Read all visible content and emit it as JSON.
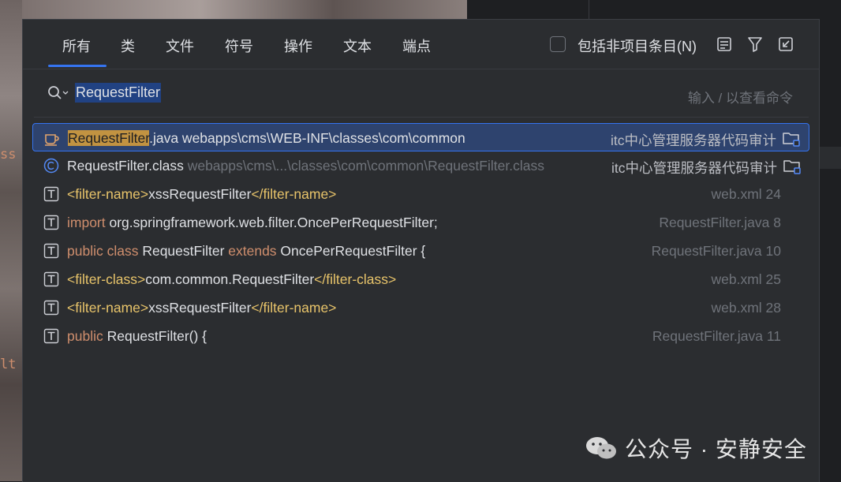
{
  "background": {
    "code_fragments": [
      "ss",
      "lt"
    ]
  },
  "tabs": [
    {
      "label": "所有",
      "active": true
    },
    {
      "label": "类"
    },
    {
      "label": "文件"
    },
    {
      "label": "符号"
    },
    {
      "label": "操作"
    },
    {
      "label": "文本"
    },
    {
      "label": "端点"
    }
  ],
  "include_non_project": {
    "label": "包括非项目条目(N)",
    "checked": false
  },
  "toolbar_icons": [
    "preview-icon",
    "filter-icon",
    "collapse-icon"
  ],
  "search": {
    "value": "RequestFilter",
    "hint": "输入 / 以查看命令"
  },
  "results": [
    {
      "icon": "java-file-icon",
      "selected": true,
      "name_highlight": "RequestFilter",
      "name_rest": ".java webapps\\cms\\WEB-INF\\classes\\com\\common",
      "project": "itc中心管理服务器代码审计"
    },
    {
      "icon": "class-icon",
      "name": "RequestFilter.class",
      "path": " webapps\\cms\\...\\classes\\com\\common\\RequestFilter.class",
      "project": "itc中心管理服务器代码审计"
    },
    {
      "icon": "text-icon",
      "parts": [
        [
          "tag",
          "<filter-name>"
        ],
        [
          "plain",
          "xssRequestFilter"
        ],
        [
          "tag",
          "</filter-name>"
        ]
      ],
      "location": "web.xml 24"
    },
    {
      "icon": "text-icon",
      "parts": [
        [
          "kw",
          "import"
        ],
        [
          "plain",
          " org.springframework.web.filter.OncePerRequestFilter;"
        ]
      ],
      "location": "RequestFilter.java 8"
    },
    {
      "icon": "text-icon",
      "parts": [
        [
          "kw",
          "public class"
        ],
        [
          "plain",
          " RequestFilter "
        ],
        [
          "kw",
          "extends"
        ],
        [
          "plain",
          " OncePerRequestFilter {"
        ]
      ],
      "location": "RequestFilter.java 10"
    },
    {
      "icon": "text-icon",
      "parts": [
        [
          "tag",
          "<filter-class>"
        ],
        [
          "plain",
          "com.common.RequestFilter"
        ],
        [
          "tag",
          "</filter-class>"
        ]
      ],
      "location": "web.xml 25"
    },
    {
      "icon": "text-icon",
      "parts": [
        [
          "tag",
          "<filter-name>"
        ],
        [
          "plain",
          "xssRequestFilter"
        ],
        [
          "tag",
          "</filter-name>"
        ]
      ],
      "location": "web.xml 28"
    },
    {
      "icon": "text-icon",
      "parts": [
        [
          "kw",
          "public"
        ],
        [
          "plain",
          " RequestFilter() {"
        ]
      ],
      "location": "RequestFilter.java 11"
    }
  ],
  "watermark": "公众号 · 安静安全",
  "colors": {
    "accent": "#3574f0",
    "selected_row": "#2e436e",
    "highlight": "#c29341",
    "keyword": "#cf8e6d",
    "xml_tag": "#e8c46a"
  }
}
